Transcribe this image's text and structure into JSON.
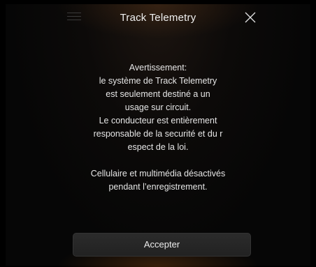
{
  "header": {
    "title": "Track Telemetry",
    "menu_icon": "menu-icon",
    "close_icon": "close-icon"
  },
  "message": {
    "warning_lines": [
      "Avertissement:",
      "le système de Track Telemetry",
      "est seulement destiné a un",
      "usage sur circuit.",
      "Le conducteur est entièrement",
      "responsable de la securité et du r",
      "espect de la loi."
    ],
    "info_lines": [
      "Cellulaire et multimédia désactivés",
      "pendant l’enregistrement."
    ]
  },
  "actions": {
    "accept_label": "Accepter"
  },
  "colors": {
    "background": "#000000",
    "text": "#e6e6e6",
    "button_bg": "#262626",
    "accent_glow": "#8c501e"
  }
}
